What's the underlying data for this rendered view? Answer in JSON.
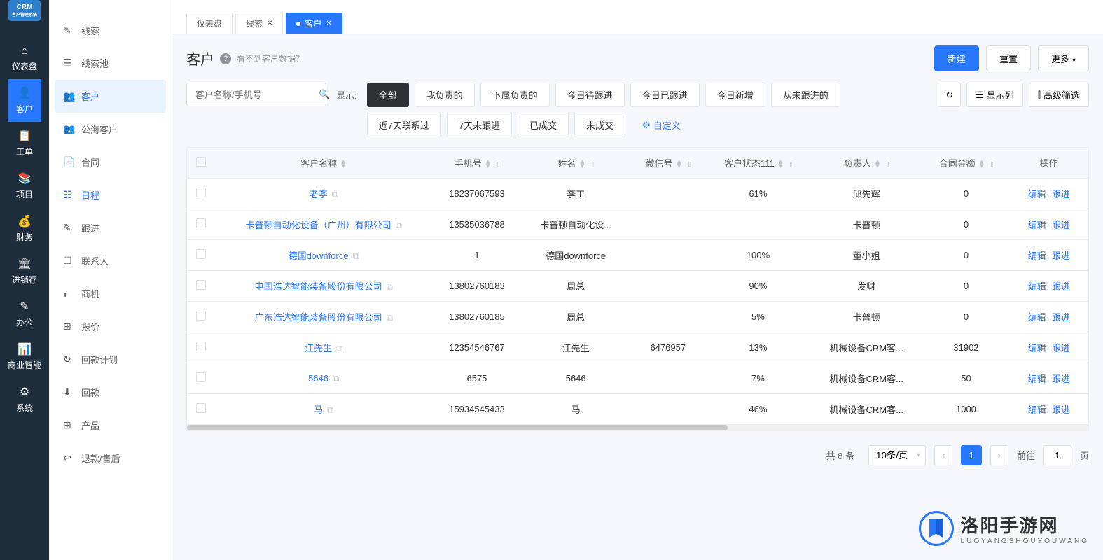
{
  "logo": {
    "title": "CRM",
    "subtitle": "客户管理系统"
  },
  "darkNav": [
    {
      "icon": "⌂",
      "label": "仪表盘"
    },
    {
      "icon": "👤",
      "label": "客户",
      "active": true
    },
    {
      "icon": "📋",
      "label": "工单"
    },
    {
      "icon": "📚",
      "label": "项目"
    },
    {
      "icon": "💰",
      "label": "财务"
    },
    {
      "icon": "🏛",
      "label": "进销存"
    },
    {
      "icon": "✎",
      "label": "办公"
    },
    {
      "icon": "📊",
      "label": "商业智能"
    },
    {
      "icon": "⚙",
      "label": "系统"
    }
  ],
  "lightNav": [
    {
      "icon": "✎",
      "label": "线索"
    },
    {
      "icon": "☰",
      "label": "线索池"
    },
    {
      "icon": "👥",
      "label": "客户",
      "active": true
    },
    {
      "icon": "👥",
      "label": "公海客户"
    },
    {
      "icon": "📄",
      "label": "合同"
    },
    {
      "icon": "☷",
      "label": "日程",
      "highlight": true
    },
    {
      "icon": "✎",
      "label": "跟进"
    },
    {
      "icon": "☐",
      "label": "联系人"
    },
    {
      "icon": "◐",
      "label": "商机"
    },
    {
      "icon": "⊞",
      "label": "报价"
    },
    {
      "icon": "↻",
      "label": "回款计划"
    },
    {
      "icon": "⬇",
      "label": "回款"
    },
    {
      "icon": "⊞",
      "label": "产品"
    },
    {
      "icon": "↩",
      "label": "退款/售后"
    }
  ],
  "tabs": [
    {
      "label": "仪表盘",
      "closable": false
    },
    {
      "label": "线索",
      "closable": true
    },
    {
      "label": "客户",
      "closable": true,
      "active": true,
      "dot": true
    }
  ],
  "page": {
    "title": "客户",
    "helpText": "看不到客户数据？",
    "searchPlaceholder": "客户名称/手机号"
  },
  "headerButtons": {
    "new": "新建",
    "reset": "重置",
    "more": "更多"
  },
  "filterBar": {
    "label": "显示:",
    "chips": [
      "全部",
      "我负责的",
      "下属负责的",
      "今日待跟进",
      "今日已跟进",
      "今日新增",
      "从未跟进的",
      "近7天联系过",
      "7天未跟进",
      "已成交",
      "未成交"
    ],
    "activeIndex": 0,
    "custom": "自定义"
  },
  "toolbar": {
    "showCols": "显示列",
    "advFilter": "高级筛选"
  },
  "table": {
    "columns": [
      "客户名称",
      "手机号",
      "姓名",
      "微信号",
      "客户状态111",
      "负责人",
      "合同金额",
      "操作"
    ],
    "rows": [
      {
        "name": "老李",
        "phone": "18237067593",
        "contact": "李工",
        "wechat": "",
        "status": "61%",
        "owner": "邱先辉",
        "amount": "0"
      },
      {
        "name": "卡普顿自动化设备（广州）有限公司",
        "phone": "13535036788",
        "contact": "卡普顿自动化设...",
        "wechat": "",
        "status": "",
        "owner": "卡普顿",
        "amount": "0"
      },
      {
        "name": "德国downforce",
        "phone": "1",
        "contact": "德国downforce",
        "wechat": "",
        "status": "100%",
        "owner": "董小姐",
        "amount": "0"
      },
      {
        "name": "中国浩达智能装备股份有限公司",
        "phone": "13802760183",
        "contact": "周总",
        "wechat": "",
        "status": "90%",
        "owner": "发财",
        "amount": "0"
      },
      {
        "name": "广东浩达智能装备股份有限公司",
        "phone": "13802760185",
        "contact": "周总",
        "wechat": "",
        "status": "5%",
        "owner": "卡普顿",
        "amount": "0"
      },
      {
        "name": "江先生",
        "phone": "12354546767",
        "contact": "江先生",
        "wechat": "6476957",
        "status": "13%",
        "owner": "机械设备CRM客...",
        "amount": "31902"
      },
      {
        "name": "5646",
        "phone": "6575",
        "contact": "5646",
        "wechat": "",
        "status": "7%",
        "owner": "机械设备CRM客...",
        "amount": "50"
      },
      {
        "name": "马",
        "phone": "15934545433",
        "contact": "马",
        "wechat": "",
        "status": "46%",
        "owner": "机械设备CRM客...",
        "amount": "1000"
      }
    ],
    "actions": {
      "edit": "编辑",
      "follow": "跟进"
    }
  },
  "pagination": {
    "totalText": "共 8 条",
    "pageSize": "10条/页",
    "current": "1",
    "gotoLabel": "前往",
    "pageSuffix": "页"
  },
  "watermark": {
    "cn": "洛阳手游网",
    "en": "LUOYANGSHOUYOUWANG"
  }
}
